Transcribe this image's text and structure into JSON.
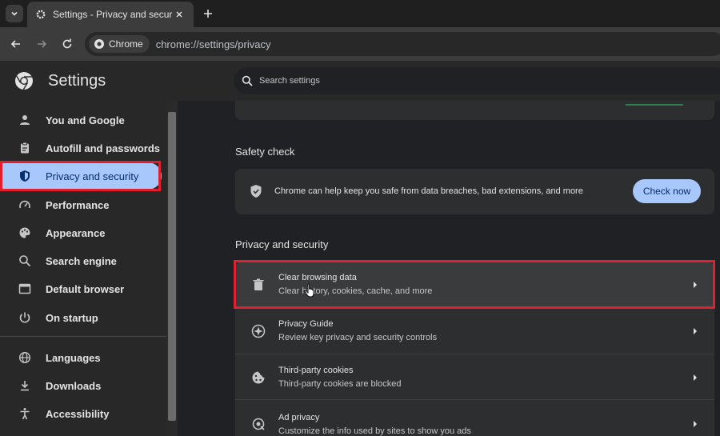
{
  "browser": {
    "tab_title": "Settings - Privacy and security",
    "chip_label": "Chrome",
    "url": "chrome://settings/privacy"
  },
  "header": {
    "title": "Settings",
    "search_placeholder": "Search settings"
  },
  "sidebar": {
    "items": [
      {
        "label": "You and Google",
        "icon": "person-icon"
      },
      {
        "label": "Autofill and passwords",
        "icon": "clipboard-icon"
      },
      {
        "label": "Privacy and security",
        "icon": "shield-icon",
        "active": true
      },
      {
        "label": "Performance",
        "icon": "speedometer-icon"
      },
      {
        "label": "Appearance",
        "icon": "palette-icon"
      },
      {
        "label": "Search engine",
        "icon": "search-icon"
      },
      {
        "label": "Default browser",
        "icon": "browser-window-icon"
      },
      {
        "label": "On startup",
        "icon": "power-icon"
      },
      {
        "label": "Languages",
        "icon": "globe-icon"
      },
      {
        "label": "Downloads",
        "icon": "download-icon"
      },
      {
        "label": "Accessibility",
        "icon": "accessibility-icon"
      }
    ]
  },
  "safety_check": {
    "title": "Safety check",
    "description": "Chrome can help keep you safe from data breaches, bad extensions, and more",
    "button_label": "Check now"
  },
  "privacy": {
    "title": "Privacy and security",
    "rows": [
      {
        "title": "Clear browsing data",
        "subtitle": "Clear history, cookies, cache, and more",
        "icon": "trash-icon"
      },
      {
        "title": "Privacy Guide",
        "subtitle": "Review key privacy and security controls",
        "icon": "privacy-guide-icon"
      },
      {
        "title": "Third-party cookies",
        "subtitle": "Third-party cookies are blocked",
        "icon": "cookie-icon"
      },
      {
        "title": "Ad privacy",
        "subtitle": "Customize the info used by sites to show you ads",
        "icon": "ad-privacy-icon"
      }
    ]
  },
  "colors": {
    "accent": "#a8c7fa",
    "highlight": "#e0202e"
  }
}
